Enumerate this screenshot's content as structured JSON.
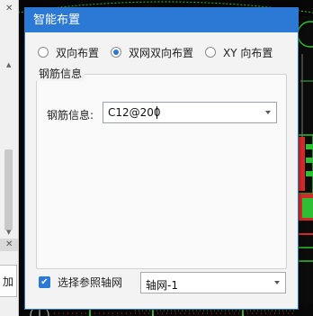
{
  "dialog": {
    "title": "智能布置",
    "layout_options": [
      {
        "label": "双向布置",
        "checked": false
      },
      {
        "label": "双网双向布置",
        "checked": true
      },
      {
        "label": "XY 向布置",
        "checked": false
      }
    ],
    "group_title": "钢筋信息",
    "rebar_label": "钢筋信息:",
    "rebar_value": "C12@200",
    "reference_checkbox_label": "选择参照轴网",
    "reference_checked": true,
    "axis_value": "轴网-1"
  },
  "left_panel": {
    "button_text": "加"
  },
  "colors": {
    "accent": "#2b79d4",
    "cad_background": "#070707",
    "cad_green": "#35c83a",
    "cad_red": "#d12a2a"
  }
}
